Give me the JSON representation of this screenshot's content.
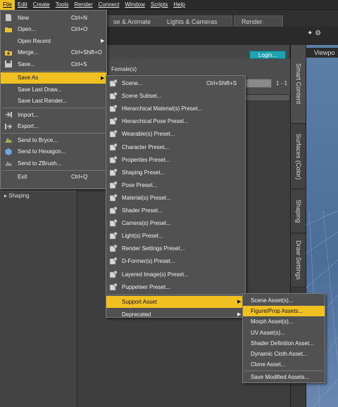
{
  "menubar": {
    "items": [
      "File",
      "Edit",
      "Create",
      "Tools",
      "Render",
      "Connect",
      "Window",
      "Scripts",
      "Help"
    ]
  },
  "background": {
    "tabs": [
      "se & Animate",
      "Lights & Cameras",
      "Render"
    ],
    "login_label": "Login...",
    "female_label": "Female(s)",
    "paging": "1 - 1",
    "shaping_label": "Shaping",
    "viewport_label": "Viewpo",
    "side_tabs": [
      "Smart Content",
      "Surfaces (Color)",
      "Shaping",
      "Draw Settings"
    ]
  },
  "file_menu": [
    {
      "label": "New",
      "shortcut": "Ctrl+N",
      "icon": "new-file-icon"
    },
    {
      "label": "Open...",
      "shortcut": "Ctrl+O",
      "icon": "open-folder-icon"
    },
    {
      "label": "Open Recent",
      "shortcut": "",
      "icon": "",
      "submenu": true
    },
    {
      "label": "Merge...",
      "shortcut": "Ctrl+Shift+O",
      "icon": "merge-icon"
    },
    {
      "label": "Save...",
      "shortcut": "Ctrl+S",
      "icon": "save-icon"
    },
    {
      "label": "Save As",
      "shortcut": "",
      "icon": "",
      "submenu": true,
      "highlighted": true
    },
    {
      "label": "Save Last Draw...",
      "shortcut": "",
      "icon": ""
    },
    {
      "label": "Save Last Render...",
      "shortcut": "",
      "icon": ""
    },
    {
      "label": "Import...",
      "shortcut": "",
      "icon": "import-icon"
    },
    {
      "label": "Export...",
      "shortcut": "",
      "icon": "export-icon"
    },
    {
      "label": "Send to Bryce...",
      "shortcut": "",
      "icon": "bryce-icon"
    },
    {
      "label": "Send to Hexagon...",
      "shortcut": "",
      "icon": "hexagon-icon"
    },
    {
      "label": "Send to ZBrush...",
      "shortcut": "",
      "icon": "zbrush-icon"
    },
    {
      "label": "Exit",
      "shortcut": "Ctrl+Q",
      "icon": ""
    }
  ],
  "save_as_menu": [
    {
      "label": "Scene...",
      "shortcut": "Ctrl+Shift+S"
    },
    {
      "label": "Scene Subset...",
      "shortcut": ""
    },
    {
      "label": "Hierarchical Material(s) Preset...",
      "shortcut": ""
    },
    {
      "label": "Hierarchical Pose Preset...",
      "shortcut": ""
    },
    {
      "label": "Wearable(s) Preset...",
      "shortcut": ""
    },
    {
      "label": "Character Preset...",
      "shortcut": ""
    },
    {
      "label": "Properties Preset...",
      "shortcut": ""
    },
    {
      "label": "Shaping Preset...",
      "shortcut": ""
    },
    {
      "label": "Pose Preset...",
      "shortcut": ""
    },
    {
      "label": "Material(s) Preset...",
      "shortcut": ""
    },
    {
      "label": "Shader Preset...",
      "shortcut": ""
    },
    {
      "label": "Camera(s) Preset...",
      "shortcut": ""
    },
    {
      "label": "Light(s) Preset...",
      "shortcut": ""
    },
    {
      "label": "Render Settings Preset...",
      "shortcut": ""
    },
    {
      "label": "D-Former(s) Preset...",
      "shortcut": ""
    },
    {
      "label": "Layered Image(s) Preset...",
      "shortcut": ""
    },
    {
      "label": "Puppeteer Preset...",
      "shortcut": ""
    },
    {
      "label": "Support Asset",
      "shortcut": "",
      "submenu": true,
      "highlighted": true
    },
    {
      "label": "Deprecated",
      "shortcut": "",
      "submenu": true
    }
  ],
  "support_asset_menu": [
    {
      "label": "Scene Asset(s)..."
    },
    {
      "label": "Figure/Prop Assets...",
      "highlighted": true
    },
    {
      "label": "Morph Asset(s)..."
    },
    {
      "label": "UV Asset(s)..."
    },
    {
      "label": "Shader Definition Asset..."
    },
    {
      "label": "Dynamic Cloth Asset..."
    },
    {
      "label": "Clone Asset..."
    },
    {
      "label": "Save Modified Assets..."
    }
  ],
  "colors": {
    "highlight": "#f0c020",
    "menu_bg": "#515151",
    "login_accent": "#1fa3b0"
  }
}
